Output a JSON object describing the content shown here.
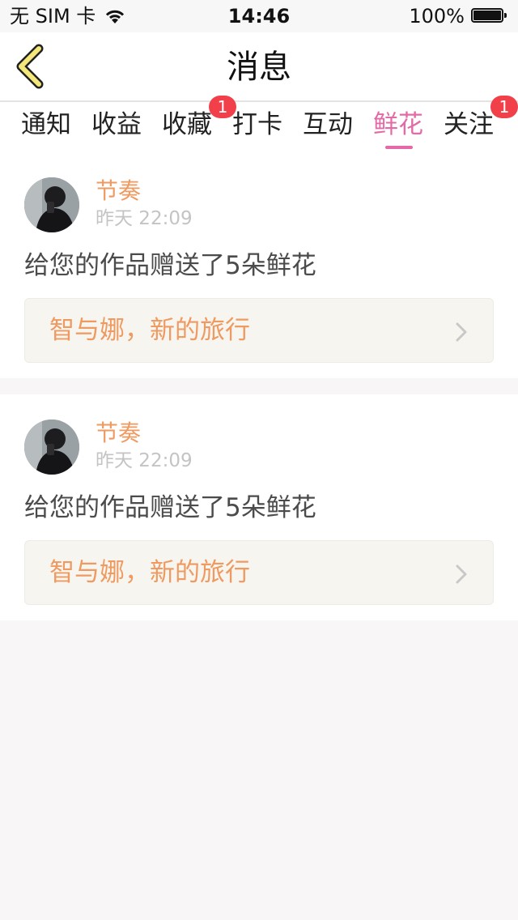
{
  "status_bar": {
    "carrier": "无 SIM 卡",
    "time": "14:46",
    "battery": "100%",
    "wifi_icon": "wifi-icon",
    "battery_icon": "battery-icon"
  },
  "header": {
    "title": "消息",
    "back_icon": "chevron-left-icon"
  },
  "tabs": [
    {
      "label": "通知",
      "active": false,
      "badge": ""
    },
    {
      "label": "收益",
      "active": false,
      "badge": ""
    },
    {
      "label": "收藏",
      "active": false,
      "badge": "1"
    },
    {
      "label": "打卡",
      "active": false,
      "badge": ""
    },
    {
      "label": "互动",
      "active": false,
      "badge": ""
    },
    {
      "label": "鲜花",
      "active": true,
      "badge": ""
    },
    {
      "label": "关注",
      "active": false,
      "badge": "1"
    }
  ],
  "messages": [
    {
      "author": "节奏",
      "time": "昨天 22:09",
      "text": "给您的作品赠送了5朵鲜花",
      "work_title": "智与娜，新的旅行"
    },
    {
      "author": "节奏",
      "time": "昨天 22:09",
      "text": "给您的作品赠送了5朵鲜花",
      "work_title": "智与娜，新的旅行"
    }
  ],
  "colors": {
    "accent": "#e46aa7",
    "author": "#ee9a61",
    "badge": "#f2404a",
    "back_icon_fill": "#f5e87a"
  }
}
